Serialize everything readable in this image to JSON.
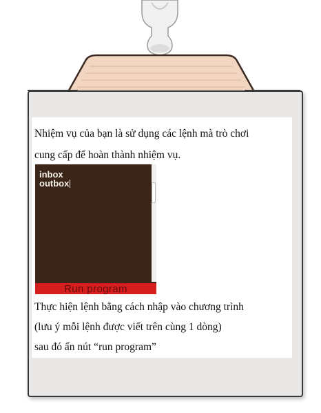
{
  "task": {
    "line1": "Nhiệm vụ của bạn là sử dụng các lệnh mà trò chơi",
    "line2": "cung cấp để hoàn thành nhiệm vụ."
  },
  "editor": {
    "lines": [
      "inbox",
      "outbox"
    ]
  },
  "run_button": {
    "label": "Run program"
  },
  "instructions": {
    "line1": "Thực hiện lệnh bằng cách nhập vào chương trình",
    "line2": "(lưu ý mỗi lệnh được viết trên cùng 1 dòng)",
    "line3": "sau đó ấn nút “run program”"
  },
  "colors": {
    "editor_bg": "#3b2418",
    "run_button": "#d51e1e",
    "board": "#e9e8e6",
    "clip_wood": "#f3d6c2"
  }
}
